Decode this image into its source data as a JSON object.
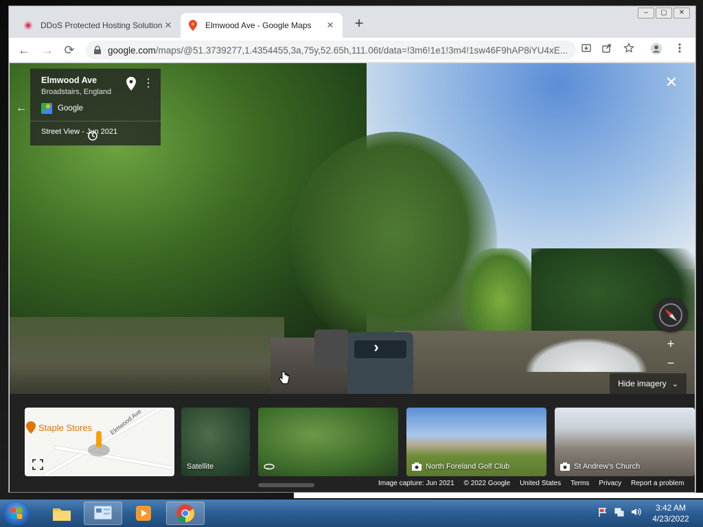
{
  "tabs": [
    {
      "title": "DDoS Protected Hosting Solution",
      "close": "✕"
    },
    {
      "title": "Elmwood Ave - Google Maps",
      "close": "✕"
    }
  ],
  "new_tab": "+",
  "window_controls": {
    "minimize": "–",
    "maximize": "▢",
    "close": "✕"
  },
  "address_bar": {
    "domain": "google.com",
    "path": "/maps/@51.3739277,1.4354455,3a,75y,52.65h,111.06t/data=!3m6!1e1!3m4!1sw46F9hAP8iYU4xE..."
  },
  "nav": {
    "back": "←",
    "forward": "→",
    "reload": "⟳"
  },
  "info_card": {
    "title": "Elmwood Ave",
    "subtitle": "Broadstairs, England",
    "provider": "Google",
    "history": "Street View - Jun 2021",
    "more": "⋮",
    "back": "←"
  },
  "close_view": "✕",
  "zoom": {
    "in": "+",
    "out": "−"
  },
  "hide_imagery": {
    "label": "Hide imagery",
    "chevron": "⌄"
  },
  "nav_arrow": "›",
  "imagery_cards": [
    {
      "type": "map",
      "place": "Staple Stores",
      "road": "Elmwood Ave"
    },
    {
      "type": "satellite",
      "label": "Satellite"
    },
    {
      "type": "street-view",
      "label": ""
    },
    {
      "type": "photo",
      "label": "North Foreland Golf Club"
    },
    {
      "type": "photo",
      "label": "St Andrew's Church"
    }
  ],
  "footer": {
    "image_capture": "Image capture: Jun 2021",
    "copyright": "© 2022 Google",
    "region": "United States",
    "terms": "Terms",
    "privacy": "Privacy",
    "report": "Report a problem"
  },
  "taskbar": {
    "time": "3:42 AM",
    "date": "4/23/2022"
  },
  "colors": {
    "accent": "#1a73e8",
    "map_place": "#e37400",
    "card_bg": "#222222"
  }
}
